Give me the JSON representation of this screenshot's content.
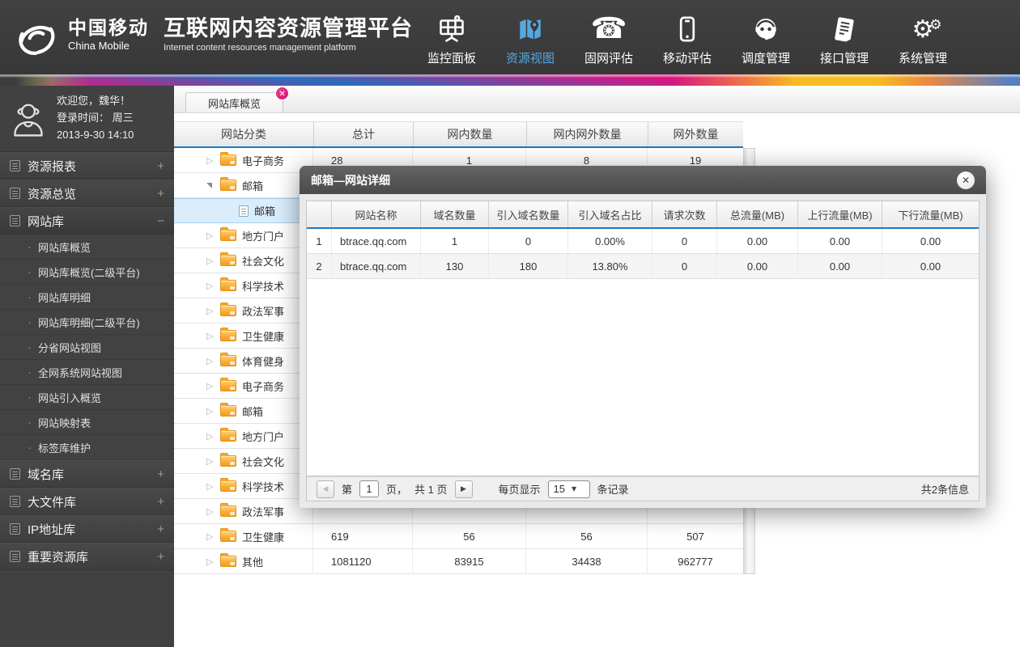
{
  "header": {
    "brand_cn": "中国移动",
    "brand_en": "China Mobile",
    "title_cn": "互联网内容资源管理平台",
    "title_en": "Internet content resources management platform",
    "nav": [
      {
        "label": "监控面板",
        "icon": "dashboard-icon"
      },
      {
        "label": "资源视图",
        "icon": "map-icon"
      },
      {
        "label": "固网评估",
        "icon": "telephone-icon"
      },
      {
        "label": "移动评估",
        "icon": "mobile-icon"
      },
      {
        "label": "调度管理",
        "icon": "headset-icon"
      },
      {
        "label": "接口管理",
        "icon": "document-icon"
      },
      {
        "label": "系统管理",
        "icon": "gears-icon"
      }
    ]
  },
  "sidebar": {
    "user": {
      "welcome": "欢迎您，魏华！",
      "login_line": "登录时间： 周三",
      "login_time": "2013-9-30  14:10"
    },
    "groups_top": [
      {
        "label": "资源报表",
        "toggle": "+"
      },
      {
        "label": "资源总览",
        "toggle": "+"
      },
      {
        "label": "网站库",
        "toggle": "−"
      }
    ],
    "website_items": [
      {
        "label": "网站库概览"
      },
      {
        "label": "网站库概览(二级平台)"
      },
      {
        "label": "网站库明细"
      },
      {
        "label": "网站库明细(二级平台)"
      },
      {
        "label": "分省网站视图"
      },
      {
        "label": "全网系统网站视图"
      },
      {
        "label": "网站引入概览"
      },
      {
        "label": "网站映射表"
      },
      {
        "label": "标签库维护"
      }
    ],
    "groups_bottom": [
      {
        "label": "域名库",
        "toggle": "+"
      },
      {
        "label": "大文件库",
        "toggle": "+"
      },
      {
        "label": "IP地址库",
        "toggle": "+"
      },
      {
        "label": "重要资源库",
        "toggle": "+"
      }
    ]
  },
  "tab": {
    "label": "网站库概览",
    "close": "✕"
  },
  "site_table": {
    "columns": [
      "网站分类",
      "总计",
      "网内数量",
      "网内网外数量",
      "网外数量"
    ],
    "rows": [
      {
        "name": "电子商务",
        "total": "28",
        "internal": "1",
        "mixed": "8",
        "external": "19"
      },
      {
        "name": "邮箱",
        "total": "",
        "internal": "",
        "mixed": "",
        "external": ""
      },
      {
        "name": "邮箱",
        "total": "",
        "internal": "",
        "mixed": "",
        "external": ""
      },
      {
        "name": "地方门户",
        "total": "",
        "internal": "",
        "mixed": "",
        "external": ""
      },
      {
        "name": "社会文化",
        "total": "",
        "internal": "",
        "mixed": "",
        "external": ""
      },
      {
        "name": "科学技术",
        "total": "",
        "internal": "",
        "mixed": "",
        "external": ""
      },
      {
        "name": "政法军事",
        "total": "",
        "internal": "",
        "mixed": "",
        "external": ""
      },
      {
        "name": "卫生健康",
        "total": "",
        "internal": "",
        "mixed": "",
        "external": ""
      },
      {
        "name": "体育健身",
        "total": "",
        "internal": "",
        "mixed": "",
        "external": ""
      },
      {
        "name": "电子商务",
        "total": "",
        "internal": "",
        "mixed": "",
        "external": ""
      },
      {
        "name": "邮箱",
        "total": "",
        "internal": "",
        "mixed": "",
        "external": ""
      },
      {
        "name": "地方门户",
        "total": "",
        "internal": "",
        "mixed": "",
        "external": ""
      },
      {
        "name": "社会文化",
        "total": "",
        "internal": "",
        "mixed": "",
        "external": ""
      },
      {
        "name": "科学技术",
        "total": "",
        "internal": "",
        "mixed": "",
        "external": ""
      },
      {
        "name": "政法军事",
        "total": "",
        "internal": "",
        "mixed": "",
        "external": ""
      },
      {
        "name": "卫生健康",
        "total": "619",
        "internal": "56",
        "mixed": "56",
        "external": "507"
      },
      {
        "name": "其他",
        "total": "1081120",
        "internal": "83915",
        "mixed": "34438",
        "external": "962777"
      }
    ]
  },
  "modal": {
    "title": "邮箱—网站详细",
    "close": "✕",
    "table": {
      "columns": [
        "",
        "网站名称",
        "域名数量",
        "引入域名数量",
        "引入域名占比",
        "请求次数",
        "总流量(MB)",
        "上行流量(MB)",
        "下行流量(MB)"
      ],
      "rows": [
        {
          "idx": "1",
          "site": "btrace.qq.com",
          "domains": "1",
          "imported": "0",
          "ratio": "0.00%",
          "requests": "0",
          "total_mb": "0.00",
          "up_mb": "0.00",
          "down_mb": "0.00"
        },
        {
          "idx": "2",
          "site": "btrace.qq.com",
          "domains": "130",
          "imported": "180",
          "ratio": "13.80%",
          "requests": "0",
          "total_mb": "0.00",
          "up_mb": "0.00",
          "down_mb": "0.00"
        }
      ]
    },
    "pagination": {
      "prev": "◀",
      "next": "▶",
      "page_prefix": "第",
      "page_value": "1",
      "page_suffix": "页，",
      "total_pages": "共 1 页",
      "per_page_label": "每页显示",
      "per_page_value": "15",
      "caret": "▼",
      "per_page_suffix": "条记录",
      "total_info": "共2条信息"
    }
  },
  "icons": {
    "collapsed_arrow": "▷",
    "bullet": "·",
    "phone_glyph": "☎",
    "gear_glyph": "⚙"
  }
}
